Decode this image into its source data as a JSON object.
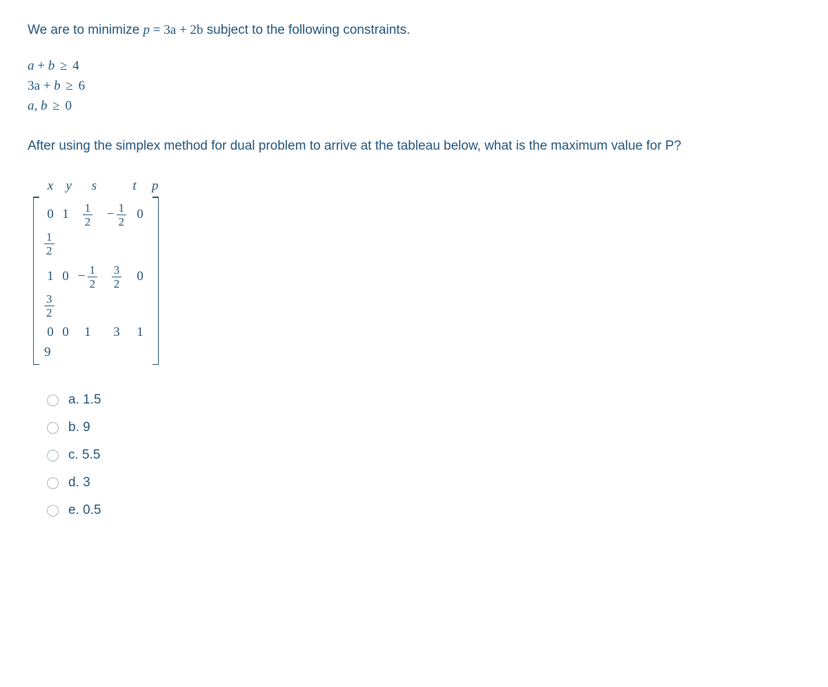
{
  "intro": {
    "prefix": "We are to minimize ",
    "p": "p",
    "eq": " = ",
    "expr_3a": "3a",
    "plus": " + ",
    "expr_2b": "2b",
    "suffix": " subject to the following constraints."
  },
  "constraints": {
    "c1": {
      "lhs_a": "a",
      "plus": " + ",
      "lhs_b": "b",
      "ge": " ≥ ",
      "rhs": "4"
    },
    "c2": {
      "lhs_3a": "3a",
      "plus": " + ",
      "lhs_b": "b",
      "ge": " ≥ ",
      "rhs": "6"
    },
    "c3": {
      "a": "a",
      "comma": ", ",
      "b": "b",
      "ge": " ≥ ",
      "rhs": "0"
    }
  },
  "after": "After using the simplex method for dual problem to arrive at the tableau below, what is the maximum value for P?",
  "matrix": {
    "headers": {
      "x": "x",
      "y": "y",
      "s": "s",
      "t": "t",
      "p": "p"
    },
    "row1": {
      "x": "0",
      "y": "1",
      "s_num": "1",
      "s_den": "2",
      "t_neg": "−",
      "t_num": "1",
      "t_den": "2",
      "p": "0",
      "aug_num": "1",
      "aug_den": "2"
    },
    "row2": {
      "x": "1",
      "y": "0",
      "s_neg": "−",
      "s_num": "1",
      "s_den": "2",
      "t_num": "3",
      "t_den": "2",
      "p": "0",
      "aug_num": "3",
      "aug_den": "2"
    },
    "row3": {
      "x": "0",
      "y": "0",
      "s": "1",
      "t": "3",
      "p": "1",
      "aug": "9"
    }
  },
  "options": {
    "a": "a. 1.5",
    "b": "b. 9",
    "c": "c. 5.5",
    "d": "d. 3",
    "e": "e. 0.5"
  }
}
